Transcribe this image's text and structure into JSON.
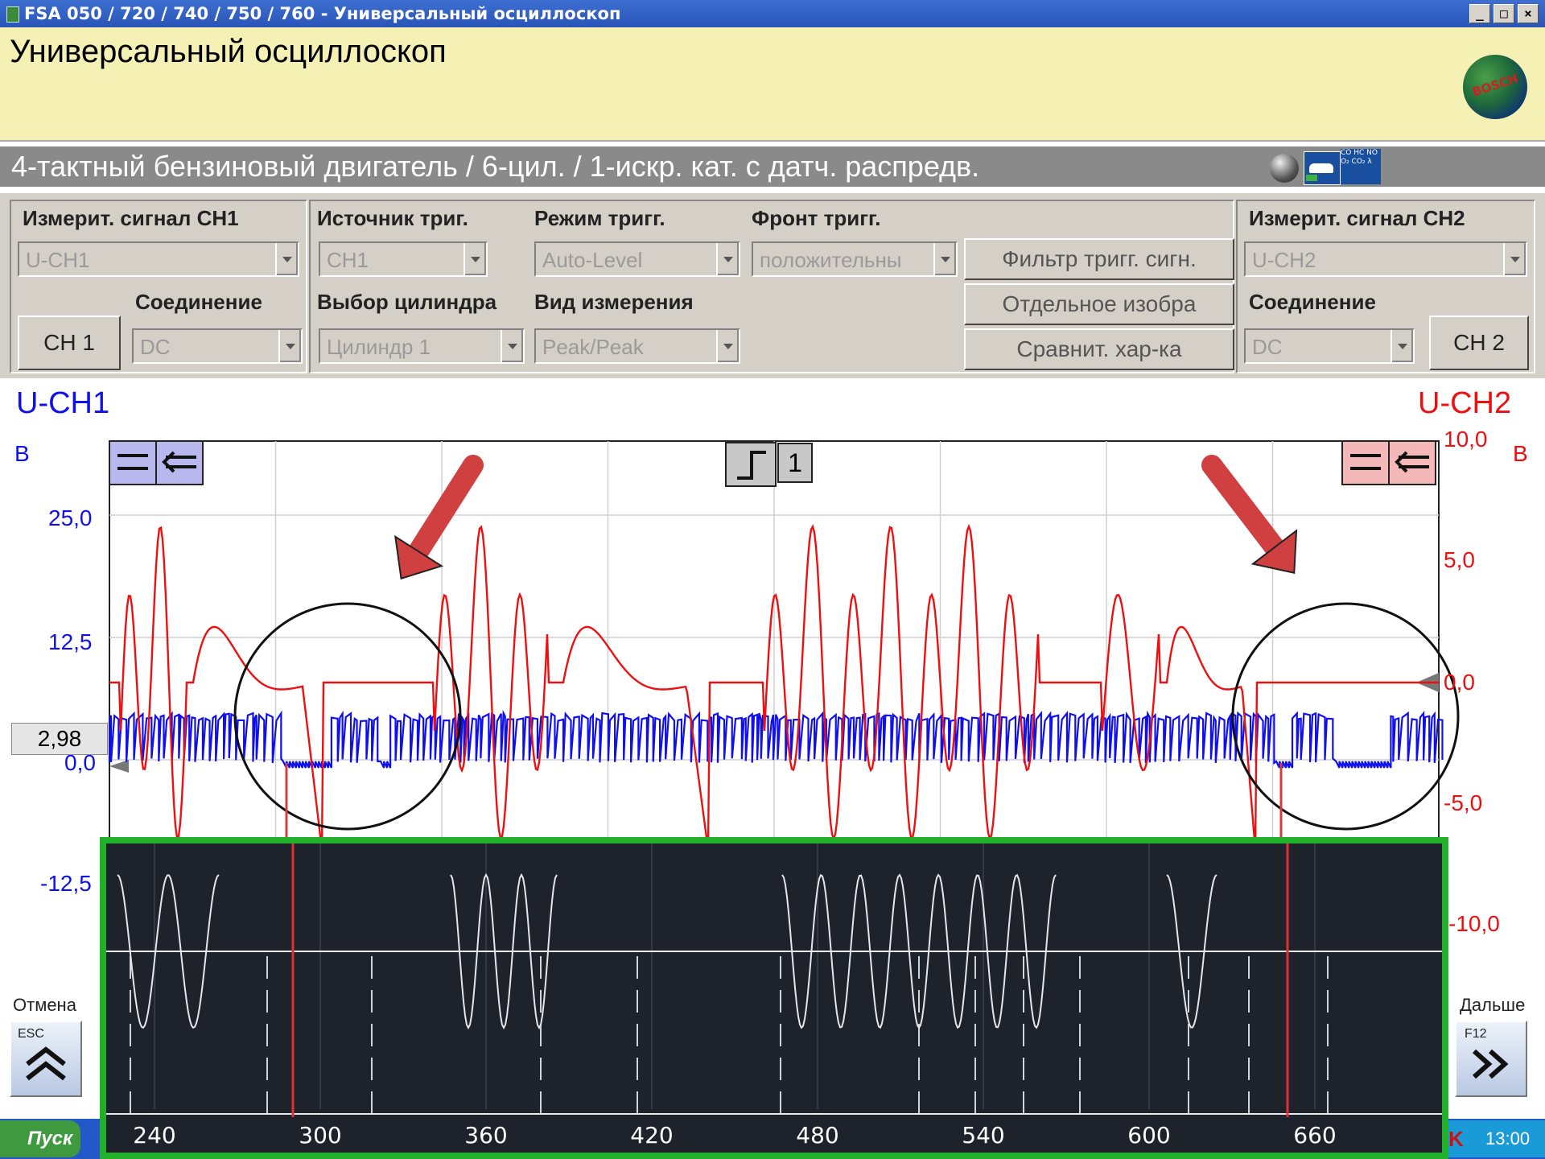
{
  "window": {
    "title": "FSA 050 / 720 / 740 / 750 / 760 - Универсальный осциллоскоп",
    "controls": [
      "_",
      "□",
      "×"
    ]
  },
  "header": {
    "title": "Универсальный осциллоскоп",
    "logo_text": "BOSCH"
  },
  "info": {
    "engine": "4-тактный бензиновый двигатель /  6-цил. / 1-искр. кат. с датч. распредв.",
    "gas_labels": "CO HC NO O₂ CO₂ λ"
  },
  "controls": {
    "ch1": {
      "label": "Измерит. сигнал CH1",
      "signal": "U-CH1",
      "coupling_label": "Соединение",
      "coupling": "DC",
      "button": "CH 1"
    },
    "trigger_source": {
      "label": "Источник триг.",
      "value": "CH1"
    },
    "trigger_mode": {
      "label": "Режим тригг.",
      "value": "Auto-Level"
    },
    "trigger_edge": {
      "label": "Фронт тригг.",
      "value": "положительны"
    },
    "cylinder": {
      "label": "Выбор цилиндра",
      "value": "Цилиндр 1"
    },
    "measure": {
      "label": "Вид измерения",
      "value": "Peak/Peak"
    },
    "buttons": {
      "filter": "Фильтр тригг. сигн.",
      "single": "Отдельное изобра",
      "compare": "Сравнит. хар-ка"
    },
    "ch2": {
      "label": "Измерит. сигнал CH2",
      "signal": "U-CH2",
      "coupling_label": "Соединение",
      "coupling": "DC",
      "button": "CH 2"
    }
  },
  "plot": {
    "ch1_title": "U-CH1",
    "ch2_title": "U-CH2",
    "ch1_unit": "В",
    "ch2_unit": "В",
    "ch1_ticks": [
      "25,0",
      "12,5",
      "0,0",
      "-12,5"
    ],
    "ch2_ticks": [
      "10,0",
      "5,0",
      "0,0",
      "-5,0",
      "-10,0"
    ],
    "trigger_level": "2,98",
    "trigger_channel": "1",
    "colors": {
      "ch1": "#1010ee",
      "ch2": "#ee1010",
      "arrow": "#d04040"
    }
  },
  "nav": {
    "cancel_label": "Отмена",
    "cancel_key": "ESC",
    "next_label": "Дальше",
    "next_key": "F12"
  },
  "inset": {
    "x_ticks": [
      "240",
      "300",
      "360",
      "420",
      "480",
      "540",
      "600",
      "660"
    ],
    "colors": {
      "border": "#22b02a",
      "background": "#1e222b",
      "marker": "#e03030"
    }
  },
  "taskbar": {
    "start": "Пуск",
    "clock": "13:00"
  }
}
